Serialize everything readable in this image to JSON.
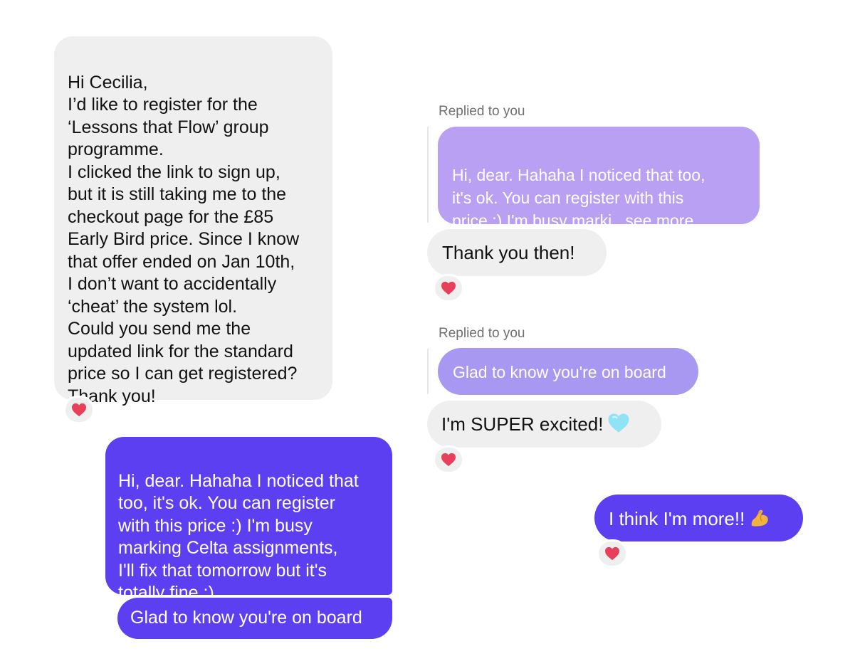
{
  "conversation": {
    "messages": [
      {
        "from": "them",
        "text": "Hi Cecilia,\nI’d like to register for the\n‘Lessons that Flow’ group\nprogramme.\nI clicked the link to sign up,\nbut it is still taking me to the\ncheckout page for the £85\nEarly Bird price. Since I know\nthat offer ended on Jan 10th,\nI don’t want to accidentally\n‘cheat’ the system lol.\nCould you send me the\nupdated link for the standard\nprice so I can get registered?\nThank you!",
        "reaction": "red-heart"
      },
      {
        "from": "me",
        "text": "Hi, dear. Hahaha I noticed that\ntoo, it's ok. You can register\nwith this price :) I'm busy\nmarking Celta assignments,\nI'll fix that tomorrow but it's\ntotally fine :)"
      },
      {
        "from": "me",
        "text": "Glad to know you're on board"
      },
      {
        "from": "them",
        "replied_label": "Replied to you",
        "reply_preview": "Hi, dear. Hahaha I noticed that too,\nit's ok. You can register with this\nprice :) I'm busy marki...see more",
        "text": "Thank you then!",
        "reaction": "red-heart"
      },
      {
        "from": "them",
        "replied_label": "Replied to you",
        "reply_preview": "Glad to know you're on board",
        "text": "I'm SUPER excited!",
        "emoji": "light-blue-heart",
        "reaction": "red-heart"
      },
      {
        "from": "me",
        "text": "I think I'm more!!",
        "emoji": "flexed-biceps",
        "reaction": "red-heart"
      }
    ]
  },
  "colors": {
    "received_bubble": "#efefef",
    "sent_bubble": "#5b3ff0",
    "reply_preview_bubble": "#b9a0f3",
    "reply_label": "#6f6f6f",
    "reaction_heart": "#e8405a",
    "blue_heart": "#8fe3f5",
    "biceps": "#f2b33d"
  }
}
